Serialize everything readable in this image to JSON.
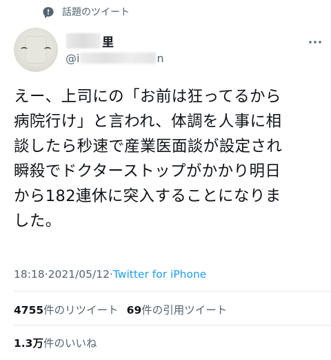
{
  "topic": {
    "label": "話題のツイート",
    "icon": "chat-bubble-icon"
  },
  "author": {
    "name_visible": "里",
    "handle_start": "@i",
    "handle_end": "n"
  },
  "tweet": {
    "text": "えー、上司にの「お前は狂ってるから\n病院行け」と言われ、体調を人事に相\n談したら秒速で産業医面談が設定され\n瞬殺でドクターストップがかかり明日\nから182連休に突入することになりま\nした。"
  },
  "meta": {
    "time": "18:18",
    "date": "2021/05/12",
    "separator": " · ",
    "source": "Twitter for iPhone"
  },
  "stats": {
    "retweets_count": "4755",
    "retweets_label": "件のリツイート",
    "quotes_count": "69",
    "quotes_label": "件の引用ツイート",
    "likes_count": "1.3万",
    "likes_label": "件のいいね"
  },
  "colors": {
    "text": "#0f1419",
    "secondary": "#536471",
    "link": "#1d9bf0",
    "divider": "#e1e8ed"
  }
}
